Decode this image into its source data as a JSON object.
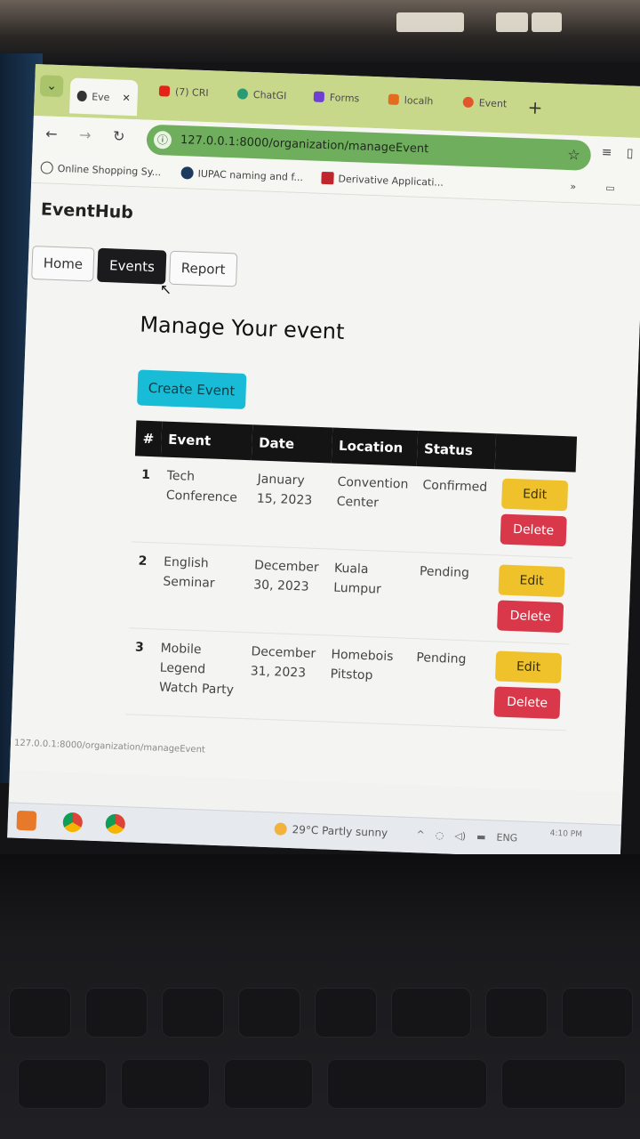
{
  "browser": {
    "tabs": [
      {
        "label": "Eve",
        "icon": "globe-icon",
        "active": true
      },
      {
        "label": "(7) CRI",
        "icon": "youtube-icon"
      },
      {
        "label": "ChatGI",
        "icon": "chatgpt-icon"
      },
      {
        "label": "Forms",
        "icon": "bootstrap-icon"
      },
      {
        "label": "localh",
        "icon": "xampp-icon"
      },
      {
        "label": "Event",
        "icon": "eventhub-icon"
      }
    ],
    "url": "127.0.0.1:8000/organization/manageEvent",
    "bookmarks": [
      {
        "label": "Online Shopping Sy...",
        "icon": "globe-icon"
      },
      {
        "label": "IUPAC naming and f...",
        "icon": "sphere-icon"
      },
      {
        "label": "Derivative Applicati...",
        "icon": "sy-icon"
      }
    ],
    "overflow_label": "»"
  },
  "app": {
    "brand": "EventHub",
    "nav": {
      "home": "Home",
      "events": "Events",
      "report": "Report"
    },
    "page_title": "Manage Your event",
    "create_button": "Create Event",
    "table": {
      "headers": [
        "#",
        "Event",
        "Date",
        "Location",
        "Status"
      ],
      "rows": [
        {
          "num": "1",
          "event": "Tech Conference",
          "date": "January 15, 2023",
          "location": "Convention Center",
          "status": "Confirmed"
        },
        {
          "num": "2",
          "event": "English Seminar",
          "date": "December 30, 2023",
          "location": "Kuala Lumpur",
          "status": "Pending"
        },
        {
          "num": "3",
          "event": "Mobile Legend Watch Party",
          "date": "December 31, 2023",
          "location": "Homebois Pitstop",
          "status": "Pending"
        }
      ],
      "edit_label": "Edit",
      "delete_label": "Delete"
    },
    "status_url": "127.0.0.1:8000/organization/manageEvent"
  },
  "taskbar": {
    "weather": "29°C  Partly sunny",
    "lang": "ENG",
    "time": "4:10 PM"
  },
  "colors": {
    "info": "#19bcd6",
    "warning": "#efc12a",
    "danger": "#d9384a",
    "dark": "#141414"
  }
}
